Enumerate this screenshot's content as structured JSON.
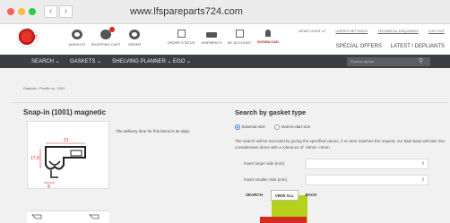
{
  "browser": {
    "url": "www.lfspareparts724.com",
    "back_glyph": "‹",
    "forward_glyph": "›"
  },
  "header": {
    "logo_text": "LF",
    "nav_icons": [
      {
        "label": "WISHLIST",
        "icon": "wishlist-icon"
      },
      {
        "label": "SHOPPING CART",
        "icon": "cart-icon"
      },
      {
        "label": "ORDER",
        "icon": "order-icon"
      },
      {
        "label": "ORDER STATUS",
        "icon": "order-status-icon"
      },
      {
        "label": "SHIPMENTS",
        "icon": "truck-icon"
      },
      {
        "label": "MY ACCOUNT",
        "icon": "account-icon"
      },
      {
        "label": "DOWNLOAD",
        "icon": "download-icon"
      }
    ],
    "toplinks": [
      "DEMO USER LF",
      "USER'S SETTINGS",
      "TECHNICAL ENQUIRIES",
      "LOG OUT"
    ],
    "secondary_links": [
      "SPECIAL OFFERS",
      "LATEST / DEPLIANTS"
    ]
  },
  "mainnav": {
    "items": [
      "SEARCH ⌄",
      "GASKETS ⌄",
      "SHELVING PLANNER ⌄",
      "EGO ⌄"
    ],
    "search_placeholder": "Ricerca rapida",
    "search_glyph": "⚲"
  },
  "breadcrumb": "Gaskets › Profile no. 1001",
  "product": {
    "title": "Snap-in (1001) magnetic",
    "delivery": "The delivery time for this items is 3e days",
    "dim_top": "21",
    "dim_left": "17,6",
    "dim_bottom": "8"
  },
  "gasket_search": {
    "title": "Search by gasket type",
    "options": [
      {
        "label": "External size",
        "selected": true
      },
      {
        "label": "Dart-to-dart size",
        "selected": false
      }
    ],
    "description": "The search will be executed by giving the specified values, if no item matches the request, our data base will take into consideration items with a tolerance of -10mm +5mm.",
    "fields": [
      {
        "label": "Insert larger side [mm]",
        "value": ""
      },
      {
        "label": "Insert smaller side [mm]",
        "value": ""
      }
    ],
    "arrows_glyph": "⇕",
    "buttons": {
      "search": "SEARCH",
      "view_all": "VIEW ALL",
      "back": "BACK"
    }
  },
  "colors": {
    "accent_red": "#d62b22",
    "nav_dark": "#3b3f42",
    "highlight_green": "#b5d11c"
  }
}
